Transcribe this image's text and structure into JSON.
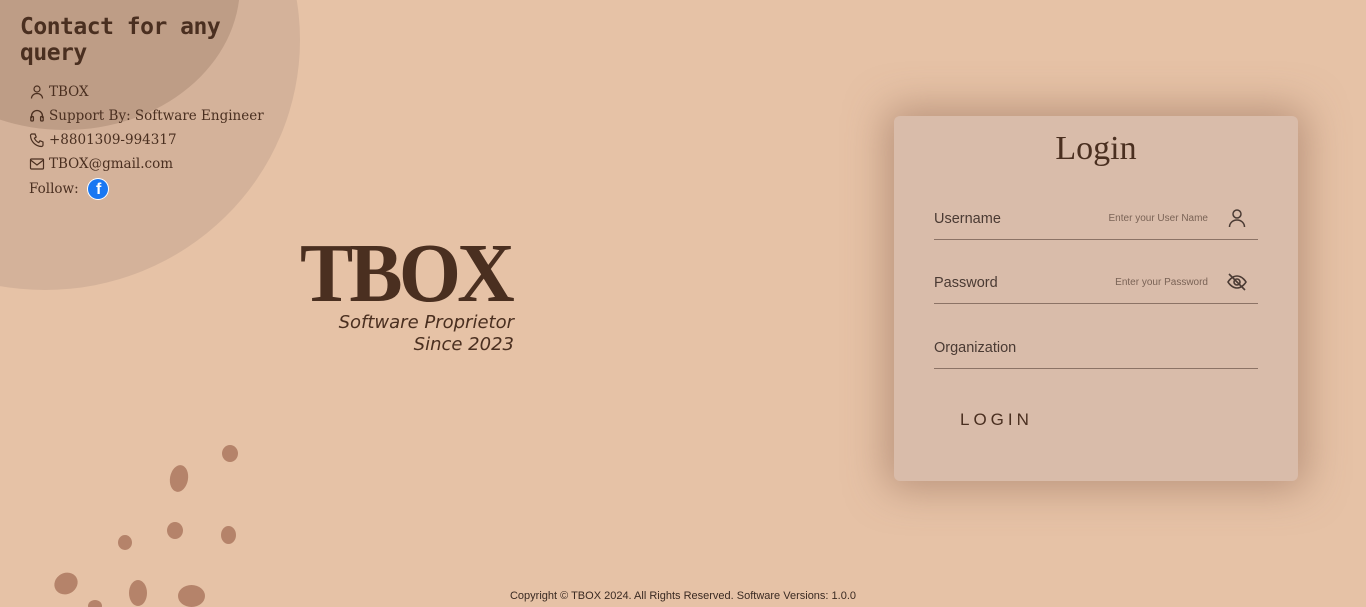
{
  "contact": {
    "title": "Contact for any query",
    "items": [
      {
        "icon": "user-icon",
        "text": "TBOX"
      },
      {
        "icon": "headset-icon",
        "text": "Support By: Software Engineer"
      },
      {
        "icon": "phone-icon",
        "text": "+8801309-994317"
      },
      {
        "icon": "mail-icon",
        "text": "TBOX@gmail.com"
      }
    ],
    "follow_label": "Follow:",
    "facebook_glyph": "f"
  },
  "logo": {
    "word": "TBOX",
    "line1": "Software Proprietor",
    "line2": "Since 2023"
  },
  "login": {
    "title": "Login",
    "username_label": "Username",
    "username_placeholder": "Enter your User Name",
    "password_label": "Password",
    "password_placeholder": "Enter your Password",
    "organization_label": "Organization",
    "button_label": "LOGIN"
  },
  "footer": {
    "text": "Copyright © TBOX 2024. All Rights Reserved. Software Versions: 1.0.0"
  },
  "colors": {
    "background": "#e6c2a6",
    "card": "#d9bcaa",
    "text_dark": "#4a2f20",
    "spots": "#b5836a",
    "facebook": "#1877f2"
  }
}
